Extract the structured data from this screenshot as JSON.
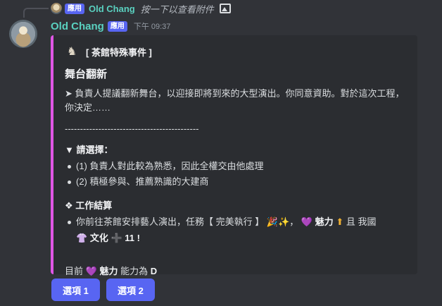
{
  "reply": {
    "app_badge": "應用",
    "name": "Old Chang",
    "text": "按一下以查看附件"
  },
  "message": {
    "username": "Old Chang",
    "app_badge": "應用",
    "timestamp": "下午 09:37"
  },
  "embed": {
    "accent_color": "#e056e5",
    "author": "[ 茶館特殊事件 ]",
    "title": "舞台翻新",
    "description": "➤ 負責人提議翻新舞台，以迎接即將到來的大型演出。你同意資助。對於這次工程，你決定……",
    "divider": "--------------------------------------------",
    "choice_heading": "▼ 請選擇：",
    "choices": [
      "(1) 負責人對此較為熟悉，因此全權交由他處理",
      "(2) 積極參與、推薦熟識的大建商"
    ],
    "result_heading": "❖ 工作結算",
    "result": {
      "prefix": "你前往茶館安排藝人演出，任務【 完美執行 】",
      "stat": "魅力",
      "and": "且 我國",
      "culture": "文化",
      "plus": "11 !"
    },
    "footer": {
      "prefix": "目前",
      "stat": "魅力",
      "middle": "能力為",
      "grade": "D"
    }
  },
  "buttons": {
    "option1": "選項 1",
    "option2": "選項 2"
  },
  "icons": [
    "image-icon",
    "heart-icon",
    "arrow-up-icon",
    "party-popper-icon",
    "sparkles-icon",
    "plus-icon",
    "culture-icon"
  ]
}
